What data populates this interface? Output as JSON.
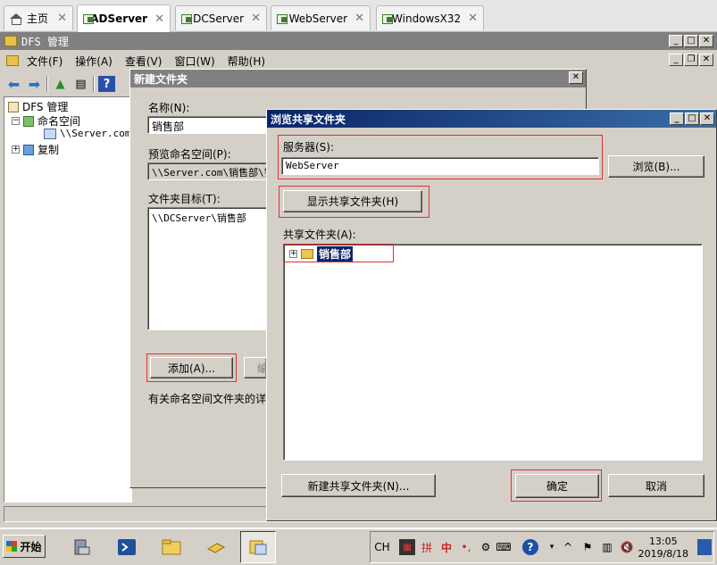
{
  "vm_tabs": [
    {
      "label": "主页",
      "icon": "home-icon"
    },
    {
      "label": "ADServer",
      "icon": "vm-icon",
      "active": true
    },
    {
      "label": "DCServer",
      "icon": "vm-icon"
    },
    {
      "label": "WebServer",
      "icon": "vm-icon"
    },
    {
      "label": "WindowsX32",
      "icon": "vm-icon"
    }
  ],
  "dfs": {
    "title": "DFS 管理",
    "menu": [
      "文件(F)",
      "操作(A)",
      "查看(V)",
      "窗口(W)",
      "帮助(H)"
    ],
    "tree": {
      "root": "DFS 管理",
      "namespaces": "命名空间",
      "namespace_item": "\\\\Server.com\\",
      "replication": "复制"
    }
  },
  "new_folder_dialog": {
    "title": "新建文件夹",
    "name_label": "名称(N):",
    "name_value": "销售部",
    "preview_label": "预览命名空间(P):",
    "preview_value": "\\\\Server.com\\销售部\\销",
    "targets_label": "文件夹目标(T):",
    "targets": [
      "\\\\DCServer\\销售部"
    ],
    "add_button": "添加(A)...",
    "edit_button": "编",
    "help_text": "有关命名空间文件夹的详"
  },
  "browse_dialog": {
    "title": "浏览共享文件夹",
    "server_label": "服务器(S):",
    "server_value": "WebServer",
    "browse_button": "浏览(B)...",
    "show_button": "显示共享文件夹(H)",
    "shared_label": "共享文件夹(A):",
    "shared_items": [
      "销售部"
    ],
    "new_share_button": "新建共享文件夹(N)...",
    "ok_button": "确定",
    "cancel_button": "取消"
  },
  "taskbar": {
    "start": "开始",
    "ime": "CH",
    "ime_lang": "中",
    "clock_time": "13:05",
    "clock_date": "2019/8/18"
  },
  "colors": {
    "dialog_active_title": "#0a246a",
    "dialog_inactive_title": "#808080",
    "highlight_box": "#e03030",
    "selection": "#0a246a"
  }
}
